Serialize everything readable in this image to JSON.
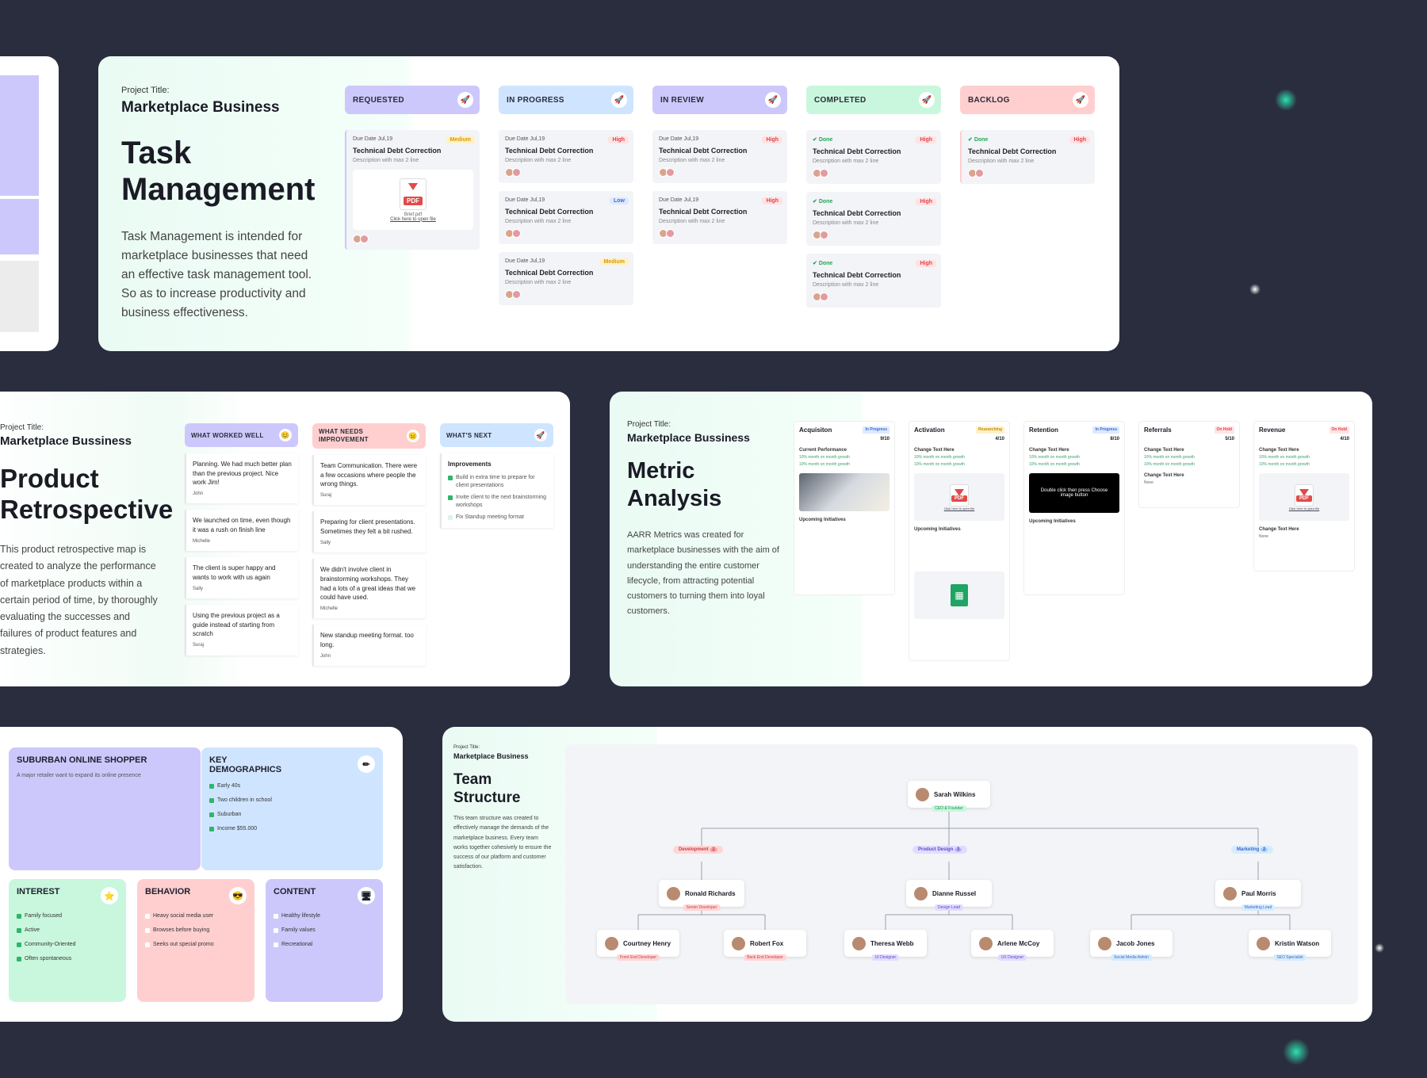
{
  "task": {
    "project_label": "Project Title:",
    "project_name": "Marketplace Business",
    "title_l1": "Task",
    "title_l2": "Management",
    "desc": "Task Management is intended for marketplace businesses that need an effective task management tool. So as to increase productivity and business effectiveness.",
    "columns": [
      {
        "name": "REQUESTED",
        "color": "#cdc8fb"
      },
      {
        "name": "IN PROGRESS",
        "color": "#cfe5ff"
      },
      {
        "name": "IN REVIEW",
        "color": "#cdc8fb"
      },
      {
        "name": "COMPLETED",
        "color": "#c9f7dd"
      },
      {
        "name": "BACKLOG",
        "color": "#ffcfd0"
      }
    ],
    "due": "Due Date Jul,19",
    "card_title": "Technical Debt Correction",
    "card_sub": "Description with max 2 line",
    "done": "Done",
    "prio_high": "High",
    "prio_med": "Medium",
    "prio_low": "Low",
    "pdf": "PDF",
    "pdf_name": "Brief.pdf",
    "pdf_link": "Click here to open file"
  },
  "retro": {
    "project_label": "Project Title:",
    "project_name": "Marketplace Bussiness",
    "title_l1": "Product",
    "title_l2": "Retrospective",
    "desc": "This product retrospective map is created to analyze the performance of marketplace products within a certain period of time, by thoroughly evaluating the successes and failures of product features and strategies.",
    "col1": "WHAT WORKED WELL",
    "col2": "WHAT NEEDS IMPROVEMENT",
    "col3": "WHAT'S NEXT",
    "worked": [
      {
        "text": "Planning. We had much better plan than the previous project. Nice work Jim!",
        "who": "John"
      },
      {
        "text": "We launched on time, even though it was a rush on finish line",
        "who": "Michelle"
      },
      {
        "text": "The client is super happy and wants to work with us again",
        "who": "Sally"
      },
      {
        "text": "Using the previous project as a guide instead of starting from scratch",
        "who": "Suraj"
      }
    ],
    "improve": [
      {
        "text": "Team Communication. There were a few occasions where people the wrong things.",
        "who": "Suraj"
      },
      {
        "text": "Preparing for client presentations. Sometimes they felt a bit rushed.",
        "who": "Sally"
      },
      {
        "text": "We didn't involve client in brainstorming workshops. They had a lots of a great ideas that we could have used.",
        "who": "Michelle"
      },
      {
        "text": "New standup meeting format. too long.",
        "who": "John"
      }
    ],
    "next_title": "Improvements",
    "next": [
      "Build in extra time to prepare for client presentations",
      "Invite client to the next brainstorming workshops",
      "Fix Standup meeting format"
    ]
  },
  "metric": {
    "project_label": "Project Title:",
    "project_name": "Marketplace Bussiness",
    "title_l1": "Metric",
    "title_l2": "Analysis",
    "desc": "AARR Metrics was created for marketplace businesses with the aim of understanding the entire customer lifecycle, from attracting potential customers to turning them into loyal customers.",
    "cols": [
      {
        "name": "Acquisiton",
        "tag": "In Progress",
        "score": "9/10",
        "sec": "Current Performance",
        "tagc": "#dde9ff",
        "tagt": "#3f6ad8"
      },
      {
        "name": "Activation",
        "tag": "Researching",
        "score": "4/10",
        "sec": "Change Text Here",
        "tagc": "#fff1c9",
        "tagt": "#c98a00"
      },
      {
        "name": "Retention",
        "tag": "In Progress",
        "score": "8/10",
        "sec": "Change Text Here",
        "tagc": "#dde9ff",
        "tagt": "#3f6ad8"
      },
      {
        "name": "Referrals",
        "tag": "On Hold",
        "score": "5/10",
        "sec": "Change Text Here",
        "tagc": "#ffe3e3",
        "tagt": "#e2434b"
      },
      {
        "name": "Revenue",
        "tag": "On Hold",
        "score": "4/10",
        "sec": "Change Text Here",
        "tagc": "#ffe3e3",
        "tagt": "#e2434b"
      }
    ],
    "growth": "10% month on month growth",
    "upcoming": "Upcoming Initiatives",
    "double": "Double click then press Choose image button",
    "file": "File Name",
    "open": "Click here to open file",
    "none": "None"
  },
  "persona": {
    "name": "SUBURBAN ONLINE SHOPPER",
    "name_desc": "A major retailer want to expand its online presence",
    "key": "KEY DEMOGRAPHICS",
    "key_items": [
      "Early 40s",
      "Two children in school",
      "Suburban",
      "Income $55.000"
    ],
    "interest": "INTEREST",
    "interest_items": [
      "Family focused",
      "Active",
      "Community-Oriented",
      "Often spontaneous"
    ],
    "behavior": "BEHAVIOR",
    "behavior_items": [
      "Heavy social media user",
      "Browses before buying",
      "Seeks out special promo"
    ],
    "content": "CONTENT",
    "content_items": [
      "Healthy lifestyle",
      "Family values",
      "Recreational"
    ]
  },
  "team": {
    "project_label": "Project Title:",
    "project_name": "Marketplace Business",
    "title_l1": "Team",
    "title_l2": "Structure",
    "desc": "This team structure was created to effectively manage the demands of the marketplace business. Every team works together cohesively to ensure the success of our platform and customer satisfaction.",
    "ceo": {
      "name": "Sarah Wilkins",
      "role": "CEO & Founder"
    },
    "depts": [
      {
        "name": "Development",
        "count": "2",
        "color": "#ffd6d6"
      },
      {
        "name": "Product Design",
        "count": "3",
        "color": "#e1dcff"
      },
      {
        "name": "Marketing",
        "count": "2",
        "color": "#d6ebff"
      }
    ],
    "leads": [
      {
        "name": "Ronald Richards",
        "role": "Senior Developer"
      },
      {
        "name": "Dianne Russel",
        "role": "Design Lead"
      },
      {
        "name": "Paul Morris",
        "role": "Marketing Lead"
      }
    ],
    "members": [
      {
        "name": "Courtney Henry",
        "role": "Front End Developer"
      },
      {
        "name": "Robert Fox",
        "role": "Back End Developer"
      },
      {
        "name": "Theresa Webb",
        "role": "UI Designer"
      },
      {
        "name": "Arlene McCoy",
        "role": "UX Designer"
      },
      {
        "name": "Jacob Jones",
        "role": "Social Media Admin"
      },
      {
        "name": "Kristin Watson",
        "role": "SEO Specialist"
      }
    ]
  },
  "colors": {
    "bg": "#2a2d3e",
    "purple": "#cdc8fb",
    "blue": "#cfe5ff",
    "green": "#c9f7dd",
    "pink": "#ffcfd0"
  }
}
